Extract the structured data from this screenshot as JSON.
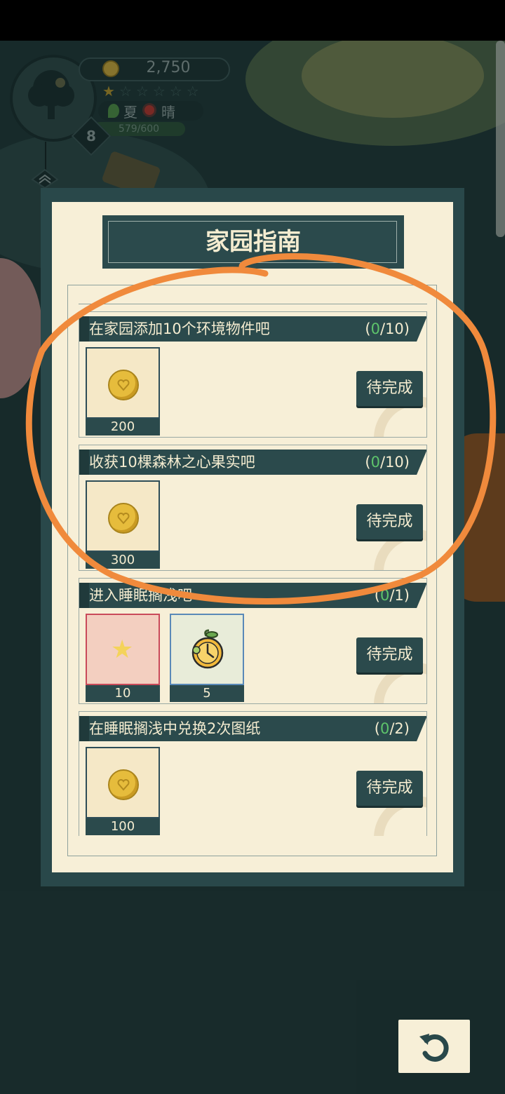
{
  "hud": {
    "coins": "2,750",
    "stars_lit": 1,
    "stars_total": 6,
    "season": "夏",
    "weather": "晴",
    "xp": "579/600",
    "level": "8"
  },
  "dialog": {
    "title": "家园指南",
    "tasks": [
      {
        "name": "在家园添加10个环境物件吧",
        "progress_current": "0",
        "progress_total": "/10)",
        "progress_open": "(",
        "status": "待完成",
        "rewards": [
          {
            "icon": "coin-icon",
            "count": "200"
          }
        ]
      },
      {
        "name": "收获10棵森林之心果实吧",
        "progress_current": "0",
        "progress_total": "/10)",
        "progress_open": "(",
        "status": "待完成",
        "rewards": [
          {
            "icon": "coin-icon",
            "count": "300"
          }
        ]
      },
      {
        "name": "进入睡眠搁浅吧",
        "progress_current": "0",
        "progress_total": "/1)",
        "progress_open": "(",
        "status": "待完成",
        "rewards": [
          {
            "icon": "star-icon",
            "count": "10"
          },
          {
            "icon": "clock-fruit-icon",
            "count": "5"
          }
        ]
      },
      {
        "name": "在睡眠搁浅中兑换2次图纸",
        "progress_current": "0",
        "progress_total": "/2)",
        "progress_open": "(",
        "status": "待完成",
        "rewards": [
          {
            "icon": "coin-icon",
            "count": "100"
          }
        ]
      }
    ]
  },
  "annotation": {
    "color": "#f08a3c",
    "shape": "hand-drawn-ellipse"
  },
  "back_button": {
    "icon": "undo-arrow-icon"
  },
  "colors": {
    "panel_dark": "#29484a",
    "panel_cream": "#f7efd7",
    "progress_green": "#5ec46b"
  }
}
